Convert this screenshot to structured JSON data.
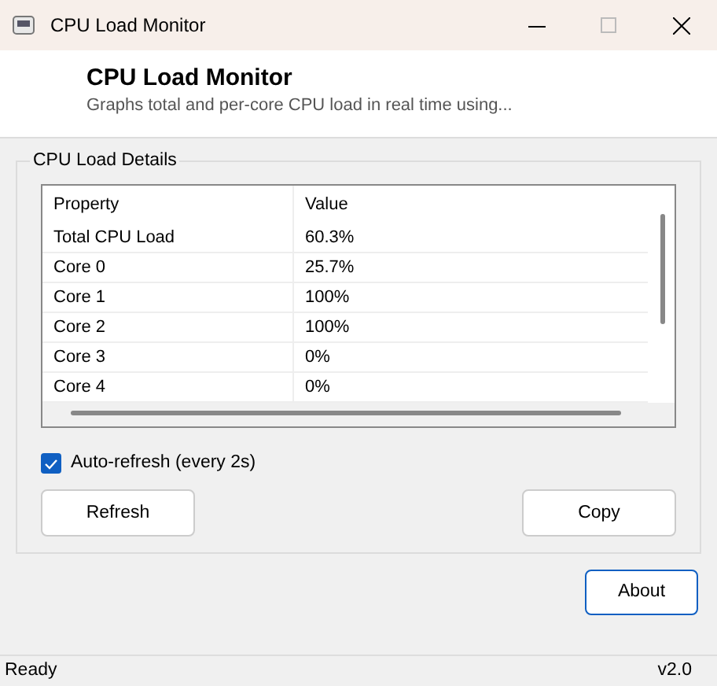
{
  "window": {
    "title": "CPU Load Monitor"
  },
  "header": {
    "title": "CPU Load Monitor",
    "subtitle": "Graphs total and per-core CPU load in real time using..."
  },
  "group": {
    "title": "CPU Load Details",
    "table": {
      "columns": [
        "Property",
        "Value"
      ],
      "rows": [
        [
          "Total CPU Load",
          "60.3%"
        ],
        [
          "Core 0",
          "25.7%"
        ],
        [
          "Core 1",
          "100%"
        ],
        [
          "Core 2",
          "100%"
        ],
        [
          "Core 3",
          "0%"
        ],
        [
          "Core 4",
          "0%"
        ]
      ]
    },
    "auto_refresh": {
      "label": "Auto-refresh (every 2s)",
      "checked": true
    },
    "buttons": [
      {
        "label": "Refresh",
        "default": false
      },
      {
        "label": "Copy",
        "default": false
      }
    ]
  },
  "about_button": {
    "label": "About",
    "default": true
  },
  "status_bar": {
    "text": "Ready",
    "version": "v2.0"
  }
}
